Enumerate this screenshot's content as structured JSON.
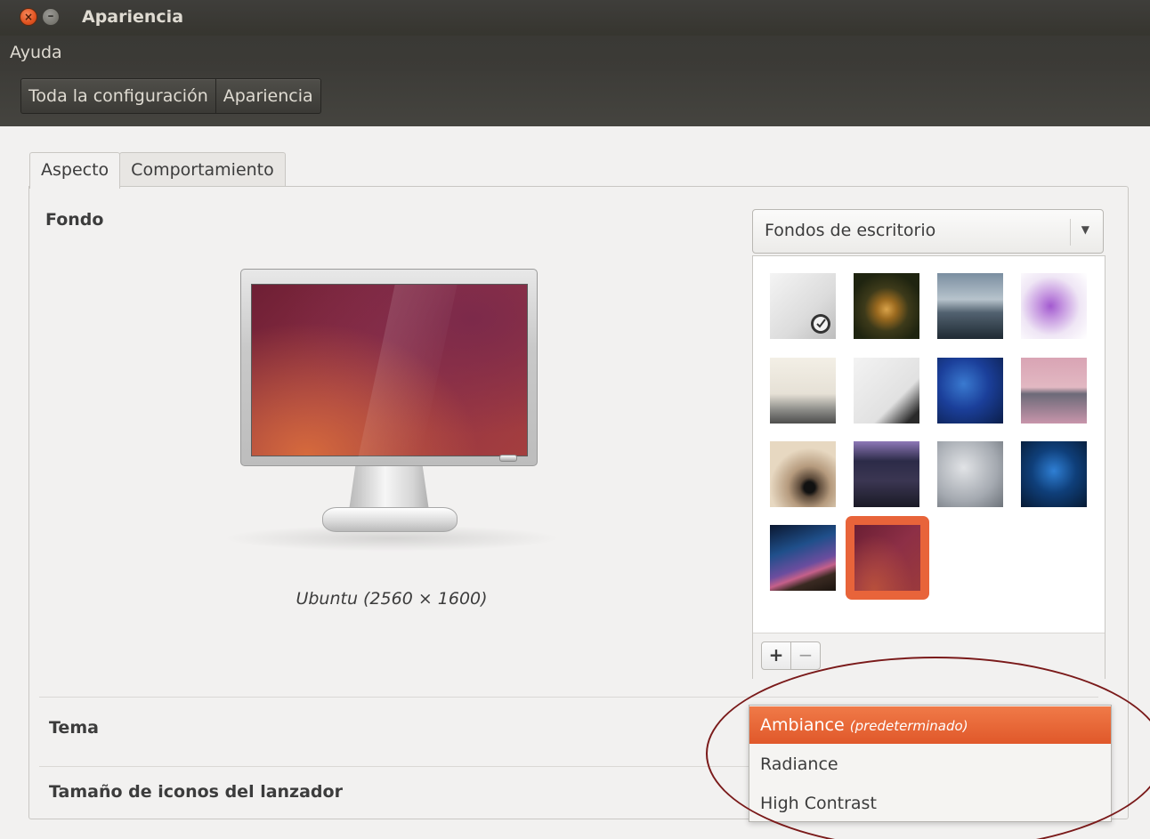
{
  "window": {
    "title": "Apariencia"
  },
  "menubar": {
    "items": [
      "Ayuda"
    ]
  },
  "breadcrumb": {
    "items": [
      "Toda la configuración",
      "Apariencia"
    ]
  },
  "tabs": [
    {
      "label": "Aspecto",
      "active": true
    },
    {
      "label": "Comportamiento",
      "active": false
    }
  ],
  "background": {
    "section_label": "Fondo",
    "preview_caption": "Ubuntu (2560 × 1600)",
    "source_dropdown": {
      "selected": "Fondos de escritorio"
    },
    "wallpapers": [
      {
        "name": "grey-warty-gecko",
        "selected": false
      },
      {
        "name": "mushroom",
        "selected": false
      },
      {
        "name": "seashore",
        "selected": false
      },
      {
        "name": "purple-flowers",
        "selected": false
      },
      {
        "name": "misty-landscape",
        "selected": false
      },
      {
        "name": "grey-partial",
        "selected": false
      },
      {
        "name": "jellyfish",
        "selected": false
      },
      {
        "name": "pink-reflection",
        "selected": false
      },
      {
        "name": "spiral-tunnel",
        "selected": false
      },
      {
        "name": "violet-light",
        "selected": false
      },
      {
        "name": "grey-sky-bird",
        "selected": false
      },
      {
        "name": "blue-network",
        "selected": false
      },
      {
        "name": "night-sky",
        "selected": false
      },
      {
        "name": "ubuntu-default",
        "selected": true
      }
    ],
    "add_label": "+",
    "remove_label": "−"
  },
  "theme": {
    "section_label": "Tema",
    "options": [
      {
        "label": "Ambiance",
        "note": "(predeterminado)",
        "selected": true
      },
      {
        "label": "Radiance",
        "note": "",
        "selected": false
      },
      {
        "label": "High Contrast",
        "note": "",
        "selected": false
      }
    ]
  },
  "launcher": {
    "section_label": "Tamaño de iconos del lanzador"
  },
  "colors": {
    "accent": "#e0582a",
    "annotation": "#7a1a1a"
  }
}
